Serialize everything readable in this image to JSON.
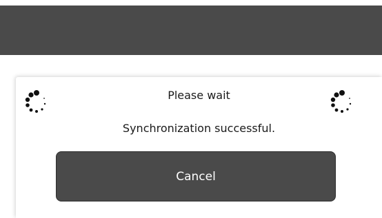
{
  "dialog": {
    "title": "Please wait",
    "message": "Synchronization successful.",
    "cancel_label": "Cancel"
  },
  "icons": {
    "spinner_left": "loading-spinner-icon",
    "spinner_right": "loading-spinner-icon"
  },
  "colors": {
    "topbar": "#4a4a4a",
    "button": "#4a4a4a",
    "button_text": "#ffffff",
    "text": "#1a1a1a"
  }
}
